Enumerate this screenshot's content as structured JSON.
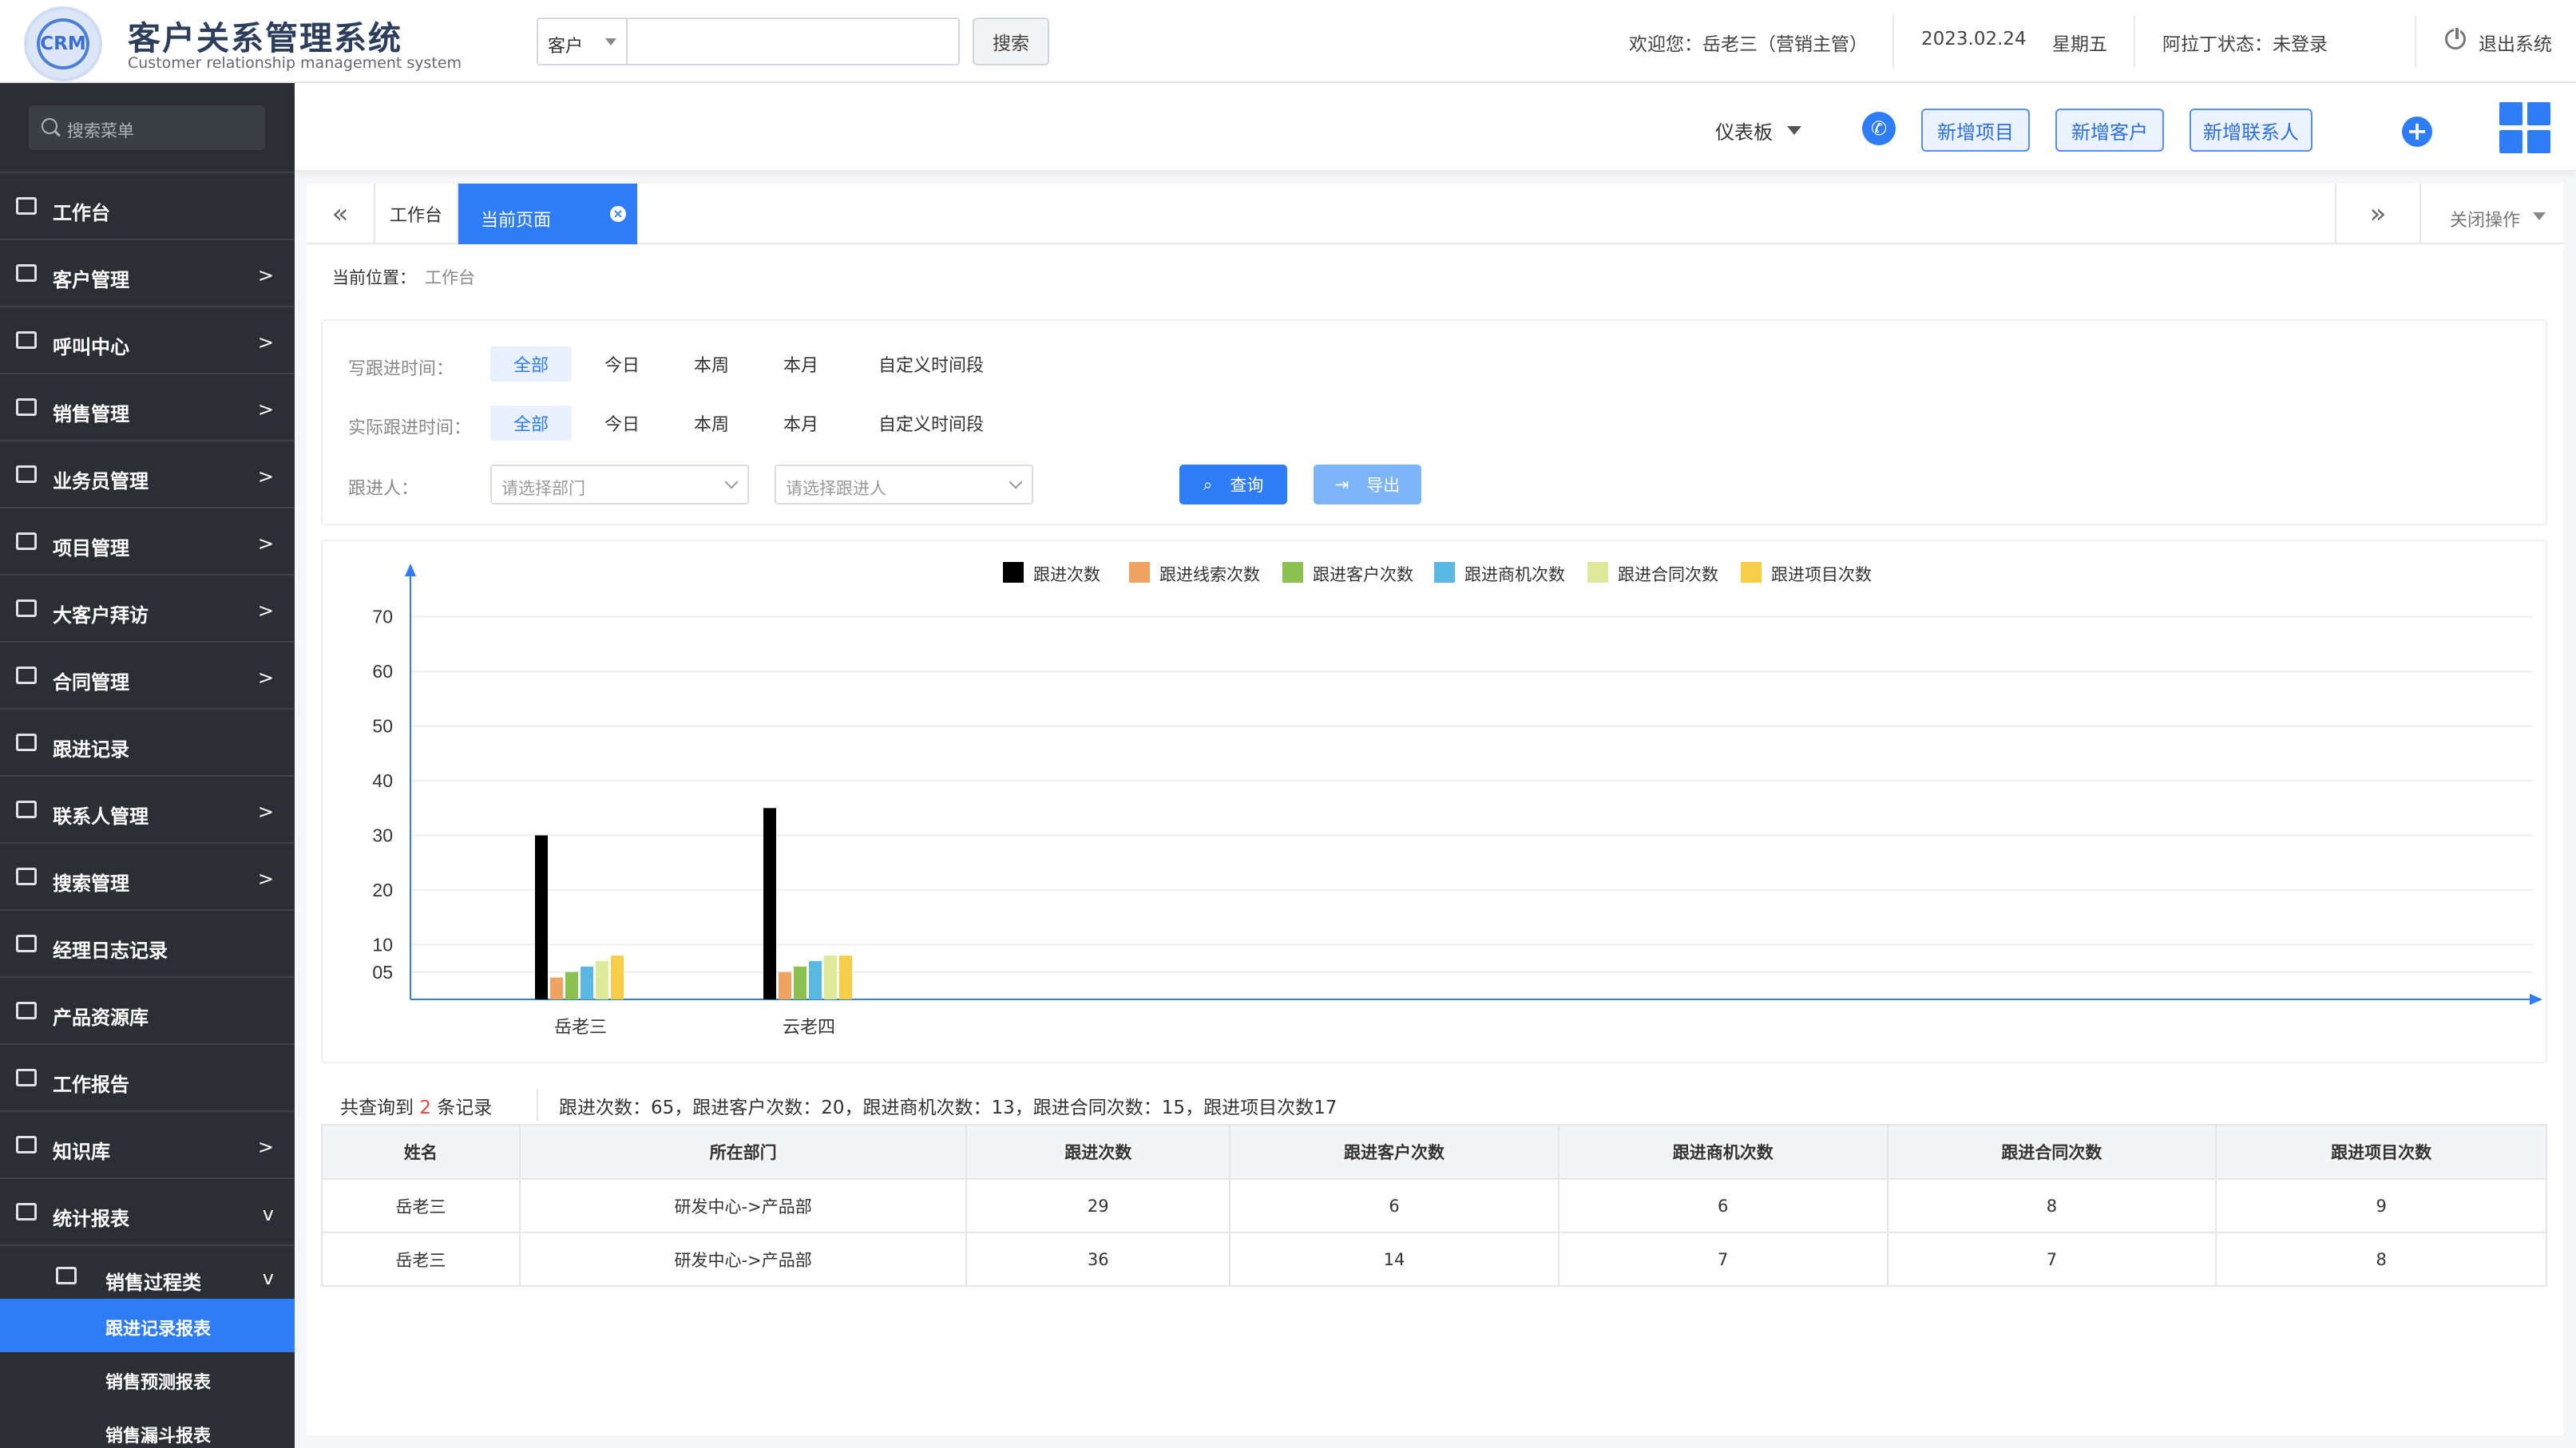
{
  "header": {
    "logo_text": "CRM",
    "title": "客户关系管理系统",
    "subtitle": "Customer relationship management system",
    "search_type": "客户",
    "search_button": "搜索",
    "welcome": "欢迎您：岳老三（营销主管）",
    "date": "2023.02.24",
    "weekday": "星期五",
    "status": "阿拉丁状态：未登录",
    "logout": "退出系统"
  },
  "sidebar": {
    "search_placeholder": "搜索菜单",
    "items": [
      {
        "label": "工作台",
        "arrow": ""
      },
      {
        "label": "客户管理",
        "arrow": ">"
      },
      {
        "label": "呼叫中心",
        "arrow": ">"
      },
      {
        "label": "销售管理",
        "arrow": ">"
      },
      {
        "label": "业务员管理",
        "arrow": ">"
      },
      {
        "label": "项目管理",
        "arrow": ">"
      },
      {
        "label": "大客户拜访",
        "arrow": ">"
      },
      {
        "label": "合同管理",
        "arrow": ">"
      },
      {
        "label": "跟进记录",
        "arrow": ""
      },
      {
        "label": "联系人管理",
        "arrow": ">"
      },
      {
        "label": "搜索管理",
        "arrow": ">"
      },
      {
        "label": "经理日志记录",
        "arrow": ""
      },
      {
        "label": "产品资源库",
        "arrow": ""
      },
      {
        "label": "工作报告",
        "arrow": ""
      },
      {
        "label": "知识库",
        "arrow": ">"
      },
      {
        "label": "统计报表",
        "arrow": "v"
      }
    ],
    "sub_group": {
      "label": "销售过程类",
      "arrow": "v"
    },
    "sub_items": [
      "跟进记录报表",
      "销售预测报表",
      "销售漏斗报表"
    ]
  },
  "topbar": {
    "dashboard": "仪表板",
    "buttons": [
      "新增项目",
      "新增客户",
      "新增联系人"
    ]
  },
  "tabs": {
    "work": "工作台",
    "current": "当前页面",
    "ops": "关闭操作"
  },
  "breadcrumb": {
    "label": "当前位置：",
    "value": "工作台"
  },
  "filters": {
    "write_time_label": "写跟进时间：",
    "actual_time_label": "实际跟进时间：",
    "options": [
      "全部",
      "今日",
      "本周",
      "本月",
      "自定义时间段"
    ],
    "person_label": "跟进人：",
    "dept_placeholder": "请选择部门",
    "person_placeholder": "请选择跟进人",
    "query": "查询",
    "export": "导出"
  },
  "colors": {
    "accent": "#2e7cf6",
    "sidebar_bg": "#2b2e33"
  },
  "chart_data": {
    "type": "bar",
    "categories": [
      "岳老三",
      "云老四"
    ],
    "series": [
      {
        "name": "跟进次数",
        "color": "#000000",
        "values": [
          30,
          35
        ]
      },
      {
        "name": "跟进线索次数",
        "color": "#f0a462",
        "values": [
          4,
          5
        ]
      },
      {
        "name": "跟进客户次数",
        "color": "#8cc152",
        "values": [
          5,
          6
        ]
      },
      {
        "name": "跟进商机次数",
        "color": "#5bb8e2",
        "values": [
          6,
          7
        ]
      },
      {
        "name": "跟进合同次数",
        "color": "#dfe99a",
        "values": [
          7,
          8
        ]
      },
      {
        "name": "跟进项目次数",
        "color": "#f5cd47",
        "values": [
          8,
          8
        ]
      }
    ],
    "yticks": [
      "05",
      "10",
      "20",
      "30",
      "40",
      "50",
      "60",
      "70"
    ],
    "ylim": [
      0,
      70
    ],
    "grid": true,
    "legend": "top-center"
  },
  "summary": {
    "prefix": "共查询到 ",
    "count": "2",
    "suffix": " 条记录",
    "text": "跟进次数：65，跟进客户次数：20，跟进商机次数：13，跟进合同次数：15，跟进项目次数17"
  },
  "table": {
    "headers": [
      "姓名",
      "所在部门",
      "跟进次数",
      "跟进客户次数",
      "跟进商机次数",
      "跟进合同次数",
      "跟进项目次数"
    ],
    "rows": [
      [
        "岳老三",
        "研发中心->产品部",
        "29",
        "6",
        "6",
        "8",
        "9"
      ],
      [
        "岳老三",
        "研发中心->产品部",
        "36",
        "14",
        "7",
        "7",
        "8"
      ]
    ]
  }
}
